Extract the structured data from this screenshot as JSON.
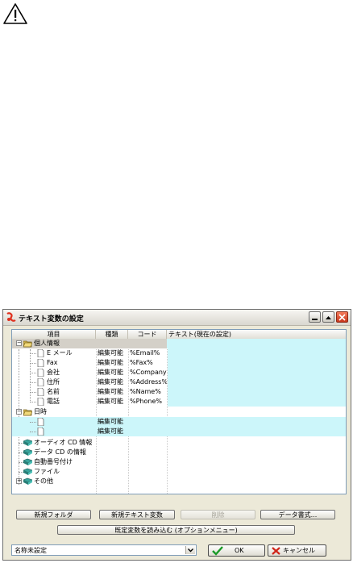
{
  "window": {
    "title": "テキスト変数の設定",
    "buttons": {
      "minimize": "minimize-icon",
      "restore": "restore-icon",
      "close": "close-icon"
    }
  },
  "columns": [
    "項目",
    "種類",
    "コード",
    "テキスト(現在の設定)"
  ],
  "tree": {
    "personal": {
      "label": "個人情報",
      "items": [
        {
          "name": "E メール",
          "type": "編集可能",
          "code": "%Email%"
        },
        {
          "name": "Fax",
          "type": "編集可能",
          "code": "%Fax%"
        },
        {
          "name": "会社",
          "type": "編集可能",
          "code": "%Company%"
        },
        {
          "name": "住所",
          "type": "編集可能",
          "code": "%Address%"
        },
        {
          "name": "名前",
          "type": "編集可能",
          "code": "%Name%"
        },
        {
          "name": "電話",
          "type": "編集可能",
          "code": "%Phone%"
        }
      ]
    },
    "date": {
      "label": "日時",
      "items": [
        {
          "name": "",
          "type": "編集可能",
          "code": ""
        },
        {
          "name": "",
          "type": "編集可能",
          "code": ""
        }
      ]
    },
    "others": [
      "オーディオ CD 情報",
      "データ CD の情報",
      "自動番号付け",
      "ファイル",
      "その他"
    ]
  },
  "buttons": {
    "new_folder": "新規フォルダ",
    "new_text_var": "新規テキスト変数",
    "delete": "削除",
    "data_format": "データ書式...",
    "load_defaults": "既定変数を読み込む (オプションメニュー)",
    "ok": "OK",
    "cancel": "キャンセル"
  },
  "preset": {
    "value": "名称未設定"
  },
  "colors": {
    "highlight": "#ccf6fa",
    "window_bg": "#ece9d8"
  }
}
